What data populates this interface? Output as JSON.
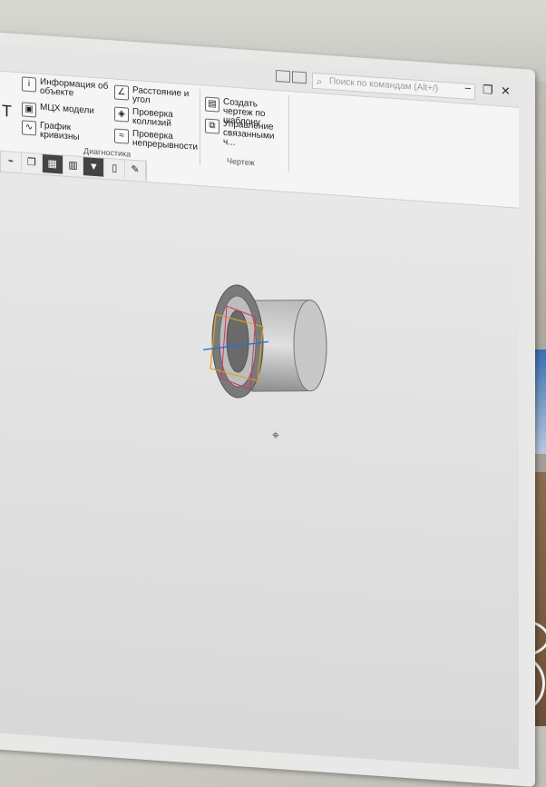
{
  "window": {
    "search_placeholder": "Поиск по командам (Alt+/)",
    "controls": [
      "−",
      "❐",
      "✕"
    ]
  },
  "ribbon": {
    "diagnostics": {
      "group_label": "Диагностика",
      "items": [
        {
          "label": "Информация об объекте",
          "icon": "info-object-icon"
        },
        {
          "label": "МЦХ модели",
          "icon": "mass-properties-icon"
        },
        {
          "label": "График кривизны",
          "icon": "curvature-graph-icon"
        },
        {
          "label": "Расстояние и угол",
          "icon": "distance-angle-icon"
        },
        {
          "label": "Проверка коллизий",
          "icon": "collision-check-icon"
        },
        {
          "label": "Проверка непрерывности",
          "icon": "continuity-check-icon"
        }
      ]
    },
    "drawings": {
      "group_label": "Чертеж",
      "items": [
        {
          "label": "Создать чертеж по шаблону",
          "icon": "drawing-template-icon"
        },
        {
          "label": "Управление связанными ч...",
          "icon": "linked-drawings-icon"
        }
      ]
    },
    "left_partial": [
      "T"
    ]
  },
  "colors": {
    "accent": "#2a6fd6",
    "model_gray": "#a9a9a9"
  }
}
